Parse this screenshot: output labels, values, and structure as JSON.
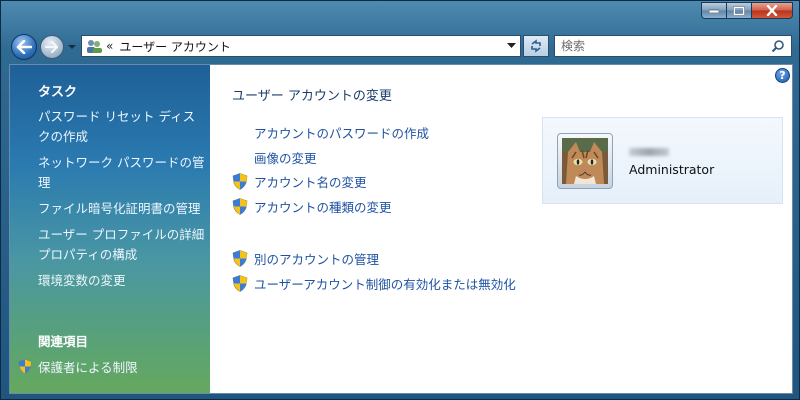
{
  "window": {
    "controls": [
      "minimize",
      "maximize",
      "close"
    ]
  },
  "navigation": {
    "breadcrumb_prefix": "«",
    "address": "ユーザー アカウント",
    "search_placeholder": "検索"
  },
  "sidebar": {
    "tasks_title": "タスク",
    "tasks": [
      {
        "label": "パスワード リセット ディスクの作成"
      },
      {
        "label": "ネットワーク パスワードの管理"
      },
      {
        "label": "ファイル暗号化証明書の管理"
      },
      {
        "label": "ユーザー プロファイルの詳細プロパティの構成"
      },
      {
        "label": "環境変数の変更"
      }
    ],
    "related_title": "関連項目",
    "related": [
      {
        "label": "保護者による制限",
        "icon": "shield-icon"
      }
    ]
  },
  "main": {
    "title": "ユーザー アカウントの変更",
    "tasks": [
      {
        "label": "アカウントのパスワードの作成",
        "shield": false
      },
      {
        "label": "画像の変更",
        "shield": false
      },
      {
        "label": "アカウント名の変更",
        "shield": true
      },
      {
        "label": "アカウントの種類の変更",
        "shield": true
      },
      {
        "label": "別のアカウントの管理",
        "shield": true
      },
      {
        "label": "ユーザーアカウント制御の有効化または無効化",
        "shield": true
      }
    ],
    "help_glyph": "?"
  },
  "account": {
    "name": "Administrator",
    "picture": "cat-avatar"
  },
  "colors": {
    "link": "#1f53a2",
    "title": "#1b3c6b",
    "sidebar_top": "#1e6097",
    "sidebar_bottom": "#65a85e"
  }
}
